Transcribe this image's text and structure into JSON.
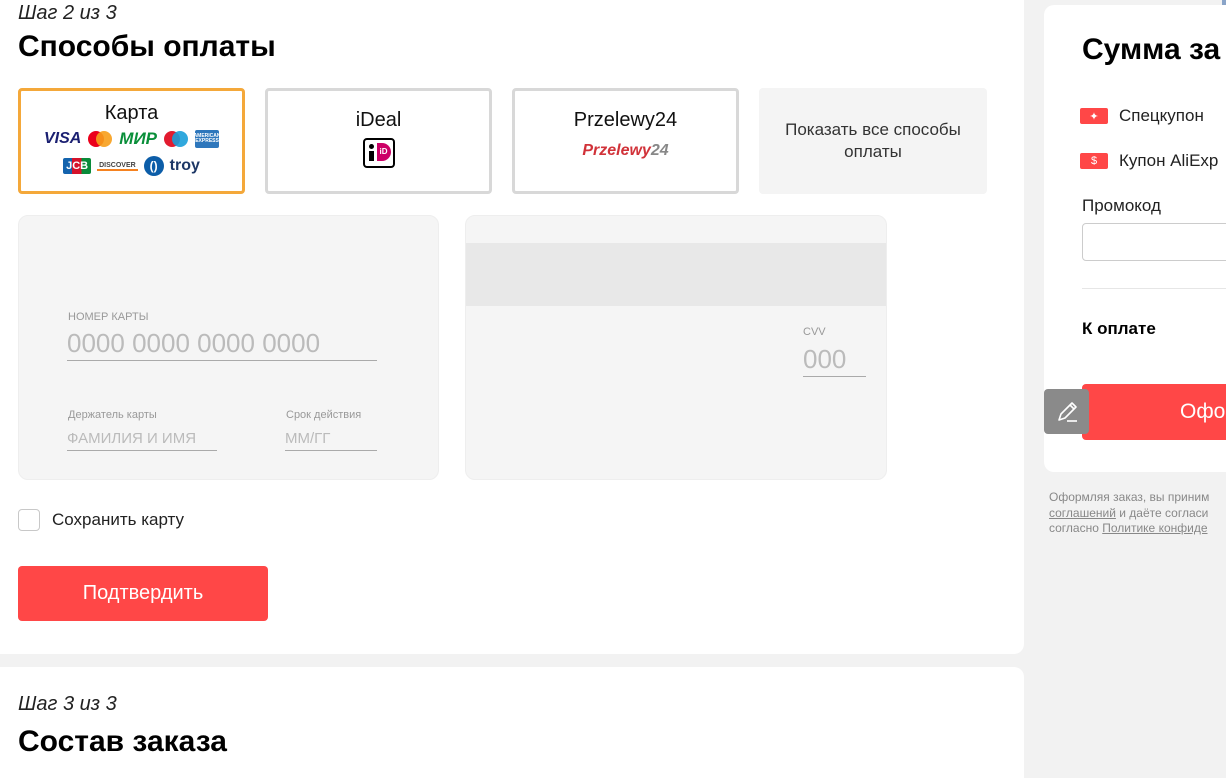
{
  "step2": {
    "label": "Шаг 2 из 3",
    "title": "Способы оплаты"
  },
  "payment_methods": {
    "card": {
      "label": "Карта",
      "logos": {
        "visa": "VISA",
        "mir": "МИР",
        "troy": "troy",
        "jcb": "JCB",
        "discover": "DISCOVER",
        "amex": "AMERICAN EXPRESS"
      }
    },
    "ideal": {
      "label": "iDeal",
      "logo_text": "iD"
    },
    "p24": {
      "label": "Przelewy24",
      "logo_part1": "Przelewy",
      "logo_part2": "24"
    },
    "more": {
      "label": "Показать все способы оплаты"
    }
  },
  "card_form": {
    "number_label": "НОМЕР КАРТЫ",
    "number_placeholder": "0000 0000 0000 0000",
    "holder_label": "Держатель карты",
    "holder_placeholder": "ФАМИЛИЯ И ИМЯ",
    "expiry_label": "Срок действия",
    "expiry_placeholder": "ММ/ГГ",
    "cvv_label": "CVV",
    "cvv_placeholder": "000"
  },
  "save_card": {
    "label": "Сохранить карту",
    "checked": false
  },
  "confirm_button": "Подтвердить",
  "step3": {
    "label": "Шаг 3 из 3",
    "title": "Состав заказа"
  },
  "summary": {
    "title": "Сумма за",
    "special_coupon": "Спецкупон",
    "aliexpress_coupon": "Купон AliExp",
    "promo_label": "Промокод",
    "promo_value": "",
    "total_label": "К оплате",
    "checkout_button": "Офо"
  },
  "legal": {
    "line1": "Оформляя заказ, вы приним",
    "link1": "соглашений",
    "line2_rest": " и даёте согласи",
    "line3_start": "согласно ",
    "link2": "Политике конфиде"
  },
  "colors": {
    "accent_red": "#ff4747",
    "selected_border": "#f4a83a"
  }
}
